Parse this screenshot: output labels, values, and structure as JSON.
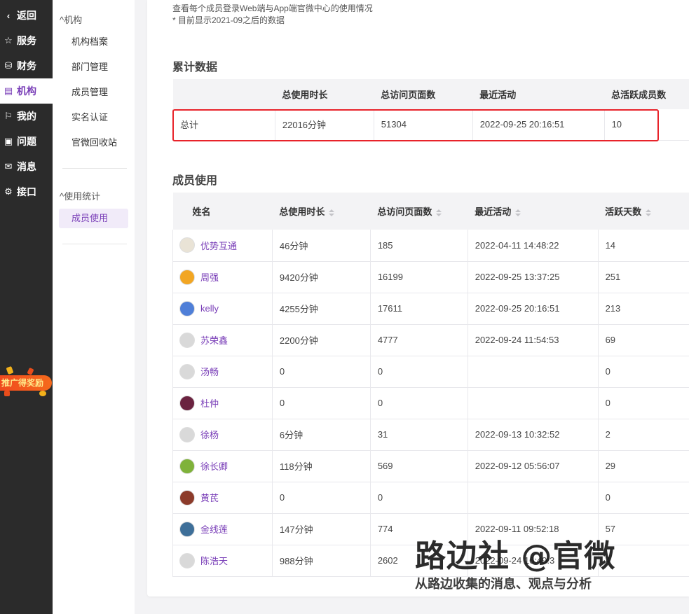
{
  "leftnav": {
    "items": [
      {
        "label": "返回",
        "icon": "chevron-left-icon"
      },
      {
        "label": "服务",
        "icon": "star-icon"
      },
      {
        "label": "财务",
        "icon": "database-icon"
      },
      {
        "label": "机构",
        "icon": "building-icon"
      },
      {
        "label": "我的",
        "icon": "bookmark-icon"
      },
      {
        "label": "问题",
        "icon": "question-icon"
      },
      {
        "label": "消息",
        "icon": "mail-icon"
      },
      {
        "label": "接口",
        "icon": "gear-icon"
      }
    ],
    "active_index": 3,
    "promo_text": "推广得奖励",
    "active_color": "#7a3fb8"
  },
  "subnav": {
    "group1": "机构",
    "group1_items": [
      "机构档案",
      "部门管理",
      "成员管理",
      "实名认证",
      "官微回收站"
    ],
    "group2": "使用统计",
    "group2_items": [
      "成员使用"
    ]
  },
  "intro": {
    "line1": "查看每个成员登录Web端与App端官微中心的使用情况",
    "line2": "* 目前显示2021-09之后的数据"
  },
  "summary": {
    "title": "累计数据",
    "headers": [
      "",
      "总使用时长",
      "总访问页面数",
      "最近活动",
      "总活跃成员数"
    ],
    "row": [
      "总计",
      "22016分钟",
      "51304",
      "2022-09-25 20:16:51",
      "10"
    ]
  },
  "members": {
    "title": "成员使用",
    "headers": [
      "姓名",
      "总使用时长",
      "总访问页面数",
      "最近活动",
      "活跃天数"
    ],
    "rows": [
      {
        "name": "优势互通",
        "duration": "46分钟",
        "pages": "185",
        "last": "2022-04-11 14:48:22",
        "days": "14",
        "avatar": "#e9e3d6"
      },
      {
        "name": "周强",
        "duration": "9420分钟",
        "pages": "16199",
        "last": "2022-09-25 13:37:25",
        "days": "251",
        "avatar": "#f2a623"
      },
      {
        "name": "kelly",
        "duration": "4255分钟",
        "pages": "17611",
        "last": "2022-09-25 20:16:51",
        "days": "213",
        "avatar": "#4f7fd8"
      },
      {
        "name": "苏荣鑫",
        "duration": "2200分钟",
        "pages": "4777",
        "last": "2022-09-24 11:54:53",
        "days": "69",
        "avatar": "#d9d9d9"
      },
      {
        "name": "汤畅",
        "duration": "0",
        "pages": "0",
        "last": "",
        "days": "0",
        "avatar": "#d9d9d9"
      },
      {
        "name": "杜仲",
        "duration": "0",
        "pages": "0",
        "last": "",
        "days": "0",
        "avatar": "#6b2340"
      },
      {
        "name": "徐杨",
        "duration": "6分钟",
        "pages": "31",
        "last": "2022-09-13 10:32:52",
        "days": "2",
        "avatar": "#d9d9d9"
      },
      {
        "name": "徐长卿",
        "duration": "118分钟",
        "pages": "569",
        "last": "2022-09-12 05:56:07",
        "days": "29",
        "avatar": "#7fb23a"
      },
      {
        "name": "黄芪",
        "duration": "0",
        "pages": "0",
        "last": "",
        "days": "0",
        "avatar": "#8c3b2a"
      },
      {
        "name": "金线莲",
        "duration": "147分钟",
        "pages": "774",
        "last": "2022-09-11 09:52:18",
        "days": "57",
        "avatar": "#3e6f99"
      },
      {
        "name": "陈浩天",
        "duration": "988分钟",
        "pages": "2602",
        "last": "2022-09-24 16:49:3",
        "days": "4",
        "avatar": "#d9d9d9"
      }
    ]
  },
  "watermark": {
    "title": "路边社 @官微",
    "subtitle": "从路边收集的消息、观点与分析"
  }
}
